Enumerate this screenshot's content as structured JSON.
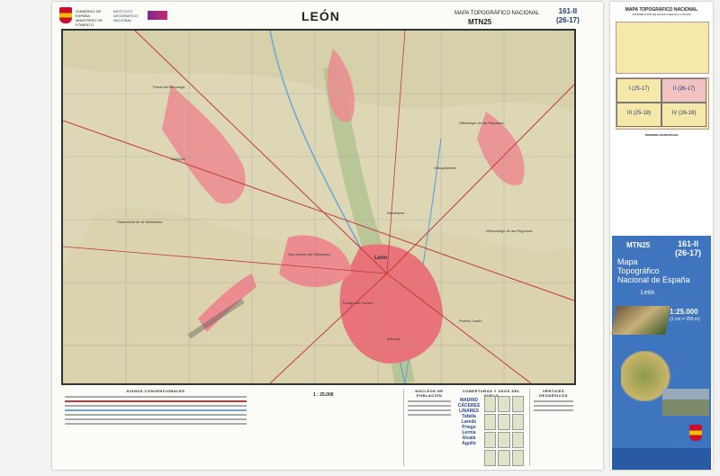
{
  "header": {
    "title": "LEÓN",
    "map_series": "MAPA TOPOGRÁFICO NACIONAL",
    "series_code": "MTN25",
    "sheet_number": "161-II",
    "sheet_grid": "(26-17)",
    "ministry": "GOBIERNO DE ESPAÑA",
    "ministry_sub": "MINISTERIO DE FOMENTO",
    "institute": "INSTITUTO GEOGRÁFICO NACIONAL"
  },
  "map": {
    "place_labels": [
      "León",
      "San Andrés del Rabanedo",
      "Villaquilambre",
      "Sariegos",
      "Trobajo del Camino",
      "Villaobispo de las Regueras",
      "Navatejera",
      "Armunia",
      "Puente Castro",
      "Santovenia de la Valdoncina",
      "Ferral del Bernesga",
      "Villarrodrigo de las Regueras"
    ],
    "colors": {
      "terrain": "#dcd6b4",
      "urban": "#e8737a",
      "green": "#a9c08a",
      "water": "#6aa6d8",
      "roads": "#c23a3a"
    }
  },
  "legend": {
    "conventional_signs": "SIGNOS CONVENCIONALES",
    "scale": "1 : 25.000",
    "population": "NÚCLEOS DE POBLACIÓN",
    "land_use": "COBERTURAS Y USOS DEL SUELO",
    "geodetic": "VÉRTICES GEODÉSICOS",
    "cities": [
      "MADRID",
      "CÁCERES",
      "LINARES",
      "Tafalla",
      "Laredo",
      "Priego",
      "Lerma",
      "Alcalá",
      "Agullo"
    ]
  },
  "right_panel": {
    "title": "MAPA TOPOGRÁFICO NACIONAL",
    "subtitle": "DISTRIBUCIÓN DE HOJAS A ESCALA 1:50.000",
    "admin_title": "DIVISIÓN ADMINISTRATIVA",
    "admin_cells": [
      "I (25-17)",
      "II (26-17)",
      "III (25-18)",
      "IV (26-18)"
    ],
    "municipal_title": "TÉRMINOS MUNICIPALES"
  },
  "cover": {
    "code": "MTN25",
    "sheet_number": "161-II",
    "sheet_grid": "(26-17)",
    "title_lines": [
      "Mapa",
      "Topográfico",
      "Nacional de España"
    ],
    "place": "León",
    "scale": "1:25.000",
    "scale_sub": "(1 cm = 250 m)"
  }
}
